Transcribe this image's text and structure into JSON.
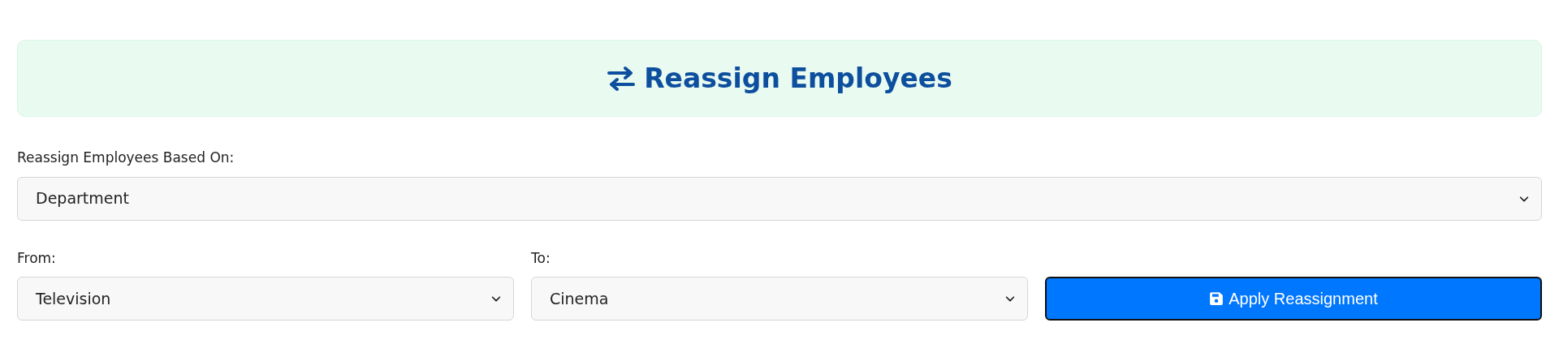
{
  "header": {
    "title": "Reassign Employees"
  },
  "basis": {
    "label": "Reassign Employees Based On:",
    "value": "Department"
  },
  "from": {
    "label": "From:",
    "value": "Television"
  },
  "to": {
    "label": "To:",
    "value": "Cinema"
  },
  "apply_button": {
    "label": "Apply Reassignment"
  }
}
